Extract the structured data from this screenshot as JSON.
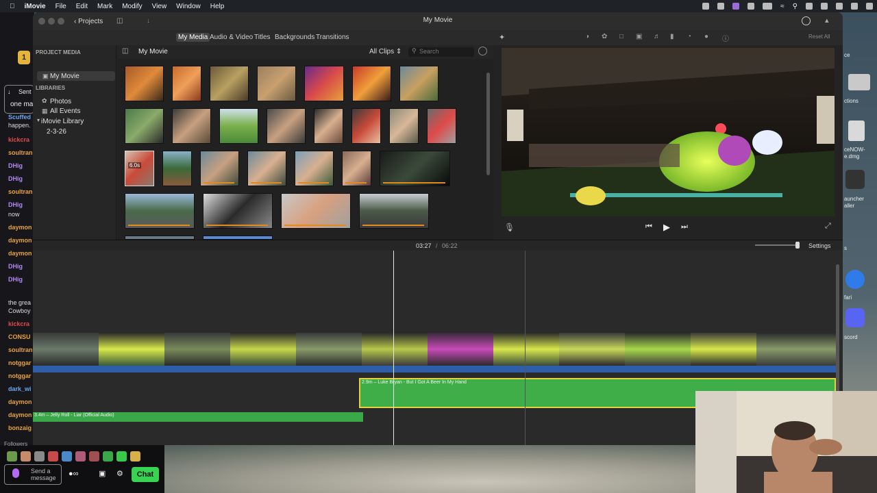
{
  "menubar": {
    "app": "iMovie",
    "items": [
      "File",
      "Edit",
      "Mark",
      "Modify",
      "View",
      "Window",
      "Help"
    ],
    "clock": ""
  },
  "window": {
    "title": "My Movie",
    "projects_label": "Projects"
  },
  "tabs": [
    "My Media",
    "Audio & Video",
    "Titles",
    "Backgrounds",
    "Transitions"
  ],
  "selected_tab": "My Media",
  "sidebar": {
    "project_media_header": "PROJECT MEDIA",
    "project_item": "My Movie",
    "libraries_header": "LIBRARIES",
    "library_items": [
      "Photos",
      "All Events",
      "iMovie Library",
      "2-3-26"
    ]
  },
  "browser": {
    "title": "My Movie",
    "filter": "All Clips",
    "search_placeholder": "Search",
    "badge": "6.0s"
  },
  "viewer": {
    "reset_label": "Reset All"
  },
  "timeline": {
    "current_time": "03:27",
    "separator": "/",
    "total_time": "06:22",
    "settings_label": "Settings",
    "music_clip_label": "2.9m – Luke Bryan - But I Got A Beer In My Hand",
    "jelly_clip_label": "3.4m – Jelly Roll - Liar (Official Audio)"
  },
  "chat": {
    "usernames": [
      "Sent",
      "Scuffed",
      "kickcra",
      "soultran",
      "DHig",
      "DHig",
      "soultran",
      "DHig",
      "daymon",
      "daymon",
      "daymon",
      "DHig",
      "DHig",
      "kickcra",
      "CONSU",
      "soultran",
      "notggar",
      "notggar",
      "dark_wi",
      "daymon",
      "daymon",
      "bonzaig"
    ],
    "messages": [
      "one ma",
      "happen.",
      "now",
      "the grea",
      "Cowboy"
    ],
    "followers_label": "Followers",
    "send_placeholder": "Send a message",
    "chat_button": "Chat",
    "colors": {
      "green": "#39d353",
      "red": "#e04b4b",
      "orange": "#e8a33a",
      "purple": "#b38af4",
      "blue": "#6aa6f0"
    }
  },
  "desktop_labels": [
    "ce",
    "ctions",
    "ceNOW-",
    "e.dmg",
    "auncher",
    "aller",
    "s",
    "fari",
    "scord"
  ]
}
